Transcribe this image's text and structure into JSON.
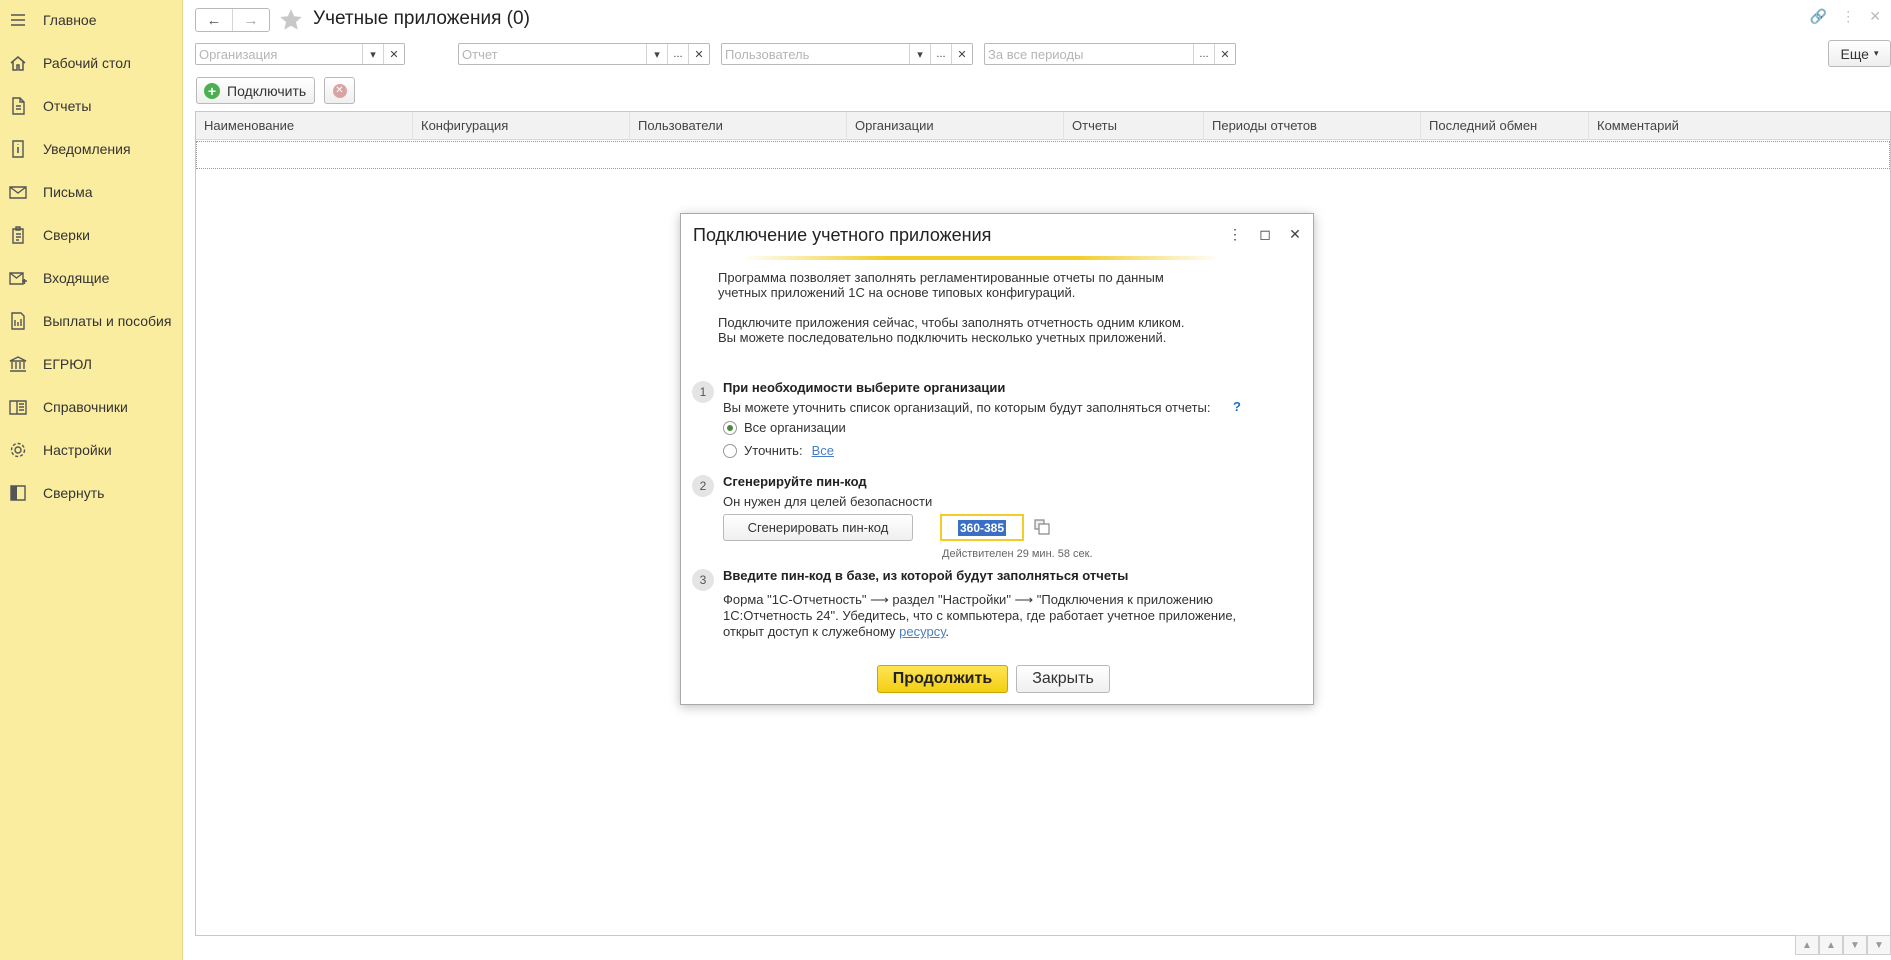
{
  "sidebar": {
    "items": [
      {
        "label": "Главное",
        "icon": "menu-icon"
      },
      {
        "label": "Рабочий стол",
        "icon": "home-icon"
      },
      {
        "label": "Отчеты",
        "icon": "document-icon"
      },
      {
        "label": "Уведомления",
        "icon": "info-icon"
      },
      {
        "label": "Письма",
        "icon": "mail-icon"
      },
      {
        "label": "Сверки",
        "icon": "clipboard-icon"
      },
      {
        "label": "Входящие",
        "icon": "inbox-mail-icon"
      },
      {
        "label": "Выплаты и пособия",
        "icon": "payments-icon"
      },
      {
        "label": "ЕГРЮЛ",
        "icon": "bank-icon"
      },
      {
        "label": "Справочники",
        "icon": "book-icon"
      },
      {
        "label": "Настройки",
        "icon": "gear-icon"
      },
      {
        "label": "Свернуть",
        "icon": "collapse-icon"
      }
    ]
  },
  "header": {
    "title": "Учетные приложения (0)"
  },
  "filters": {
    "organization_placeholder": "Организация",
    "report_placeholder": "Отчет",
    "user_placeholder": "Пользователь",
    "period_placeholder": "За все периоды",
    "more_label": "Еще"
  },
  "toolbar": {
    "connect_label": "Подключить"
  },
  "table": {
    "columns": [
      "Наименование",
      "Конфигурация",
      "Пользователи",
      "Организации",
      "Отчеты",
      "Периоды отчетов",
      "Последний обмен",
      "Комментарий"
    ]
  },
  "dialog": {
    "title": "Подключение учетного приложения",
    "intro1_line1": "Программа позволяет заполнять регламентированные отчеты по данным",
    "intro1_line2": "учетных приложений 1С на основе типовых конфигураций.",
    "intro2_line1": "Подключите приложения сейчас, чтобы заполнять отчетность одним кликом.",
    "intro2_line2": "Вы можете последовательно подключить несколько учетных приложений.",
    "step1": {
      "num": "1",
      "title": "При необходимости выберите организации",
      "desc": "Вы можете уточнить список организаций, по которым будут заполняться отчеты:",
      "help": "?",
      "option_all": "Все организации",
      "option_specify": "Уточнить:",
      "specify_link": "Все"
    },
    "step2": {
      "num": "2",
      "title": "Сгенерируйте пин-код",
      "desc": "Он нужен для целей безопасности",
      "generate_label": "Сгенерировать пин-код",
      "pin": "360-385",
      "valid": "Действителен 29 мин. 58 сек."
    },
    "step3": {
      "num": "3",
      "title": "Введите пин-код в базе, из которой будут заполняться отчеты",
      "line1": "Форма \"1С-Отчетность\" ⟶ раздел \"Настройки\" ⟶ \"Подключения к приложению",
      "line2": "1С:Отчетность 24\". Убедитесь, что с компьютера, где работает учетное приложение,",
      "line3_pre": "открыт доступ к служебному ",
      "line3_link": "ресурсу",
      "line3_post": "."
    },
    "continue_label": "Продолжить",
    "close_label": "Закрыть"
  }
}
